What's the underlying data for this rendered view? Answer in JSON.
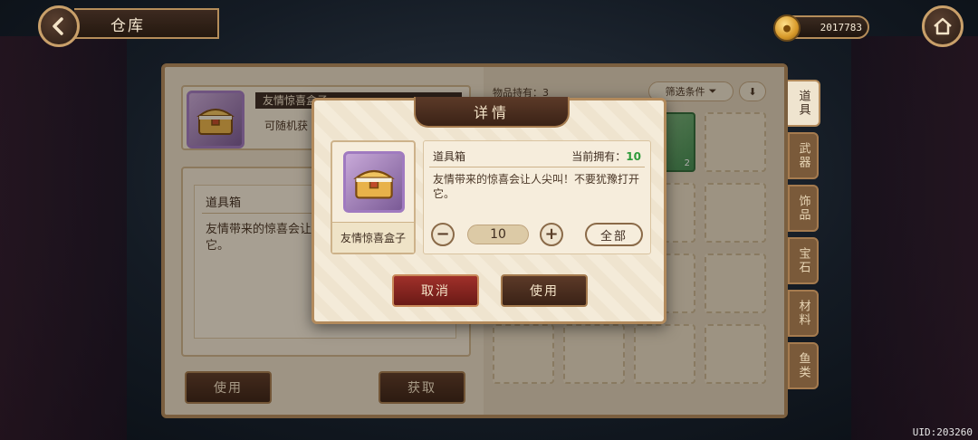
{
  "header": {
    "title": "仓库",
    "currency_amount": "2017783"
  },
  "item_detail": {
    "name": "友情惊喜盒子",
    "subtitle": "可随机获",
    "type": "道具箱",
    "description": "友情带来的惊喜会让人尖叫！不要犹豫打开它。",
    "description_truncated": "友情带来的惊喜会让\n它。"
  },
  "left_actions": {
    "use_label": "使用",
    "obtain_label": "获取"
  },
  "inventory": {
    "count_label": "物品持有：3",
    "filter_label": "筛选条件",
    "slot_count": "2"
  },
  "side_tabs": [
    "道具",
    "武器",
    "饰品",
    "宝石",
    "材料",
    "鱼类"
  ],
  "modal": {
    "title": "详情",
    "item_name": "友情惊喜盒子",
    "type": "道具箱",
    "own_label": "当前拥有：",
    "own_value": "10",
    "description": "友情带来的惊喜会让人尖叫！不要犹豫打开它。",
    "minus": "−",
    "plus": "+",
    "quantity": "10",
    "all_label": "全部",
    "cancel_label": "取消",
    "use_label": "使用"
  },
  "uid": "UID:203260",
  "colors": {
    "accent_brown": "#3a2216",
    "cancel_red": "#a0302a",
    "own_green": "#2e9a3a"
  }
}
